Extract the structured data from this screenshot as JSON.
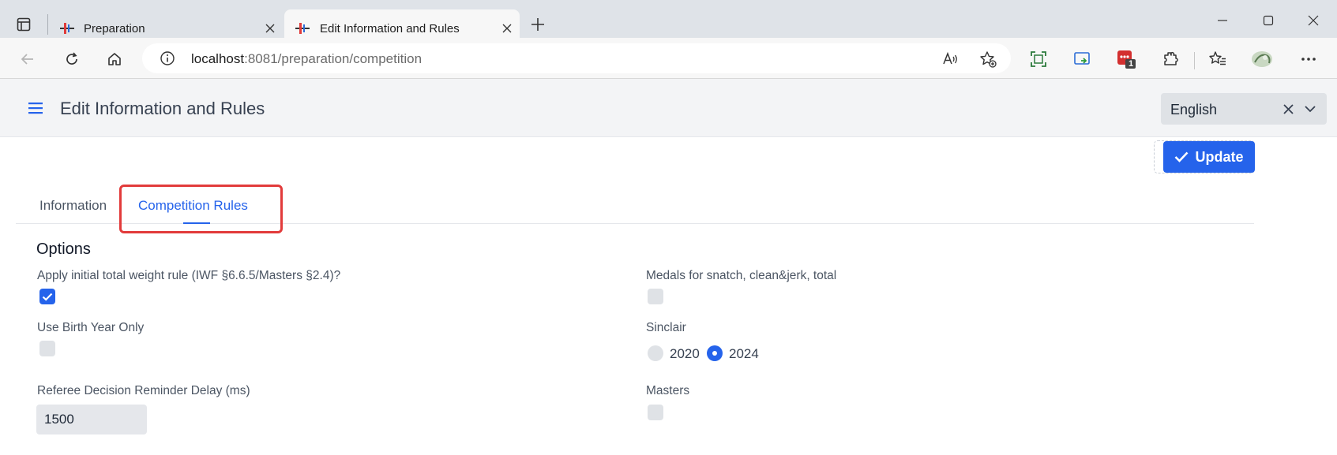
{
  "browser": {
    "tabs": [
      {
        "title": "Preparation",
        "active": false
      },
      {
        "title": "Edit Information and Rules",
        "active": true
      }
    ],
    "url_host": "localhost",
    "url_rest": ":8081/preparation/competition",
    "extension_badge": "1"
  },
  "header": {
    "title": "Edit Information and Rules",
    "language": "English"
  },
  "actions": {
    "update_label": "Update"
  },
  "tabs": [
    {
      "label": "Information",
      "active": false
    },
    {
      "label": "Competition Rules",
      "active": true
    }
  ],
  "options": {
    "section_title": "Options",
    "initial_total_rule": {
      "label": "Apply initial total weight rule (IWF §6.6.5/Masters §2.4)?",
      "checked": true
    },
    "birth_year_only": {
      "label": "Use Birth Year Only",
      "checked": false
    },
    "referee_delay": {
      "label": "Referee Decision Reminder Delay (ms)",
      "value": "1500"
    },
    "medals": {
      "label": "Medals for snatch, clean&jerk, total",
      "checked": false
    },
    "sinclair": {
      "label": "Sinclair",
      "options": [
        {
          "label": "2020",
          "selected": false
        },
        {
          "label": "2024",
          "selected": true
        }
      ]
    },
    "masters": {
      "label": "Masters",
      "checked": false
    }
  },
  "colors": {
    "accent": "#2563eb",
    "highlight": "#e23b3b"
  }
}
